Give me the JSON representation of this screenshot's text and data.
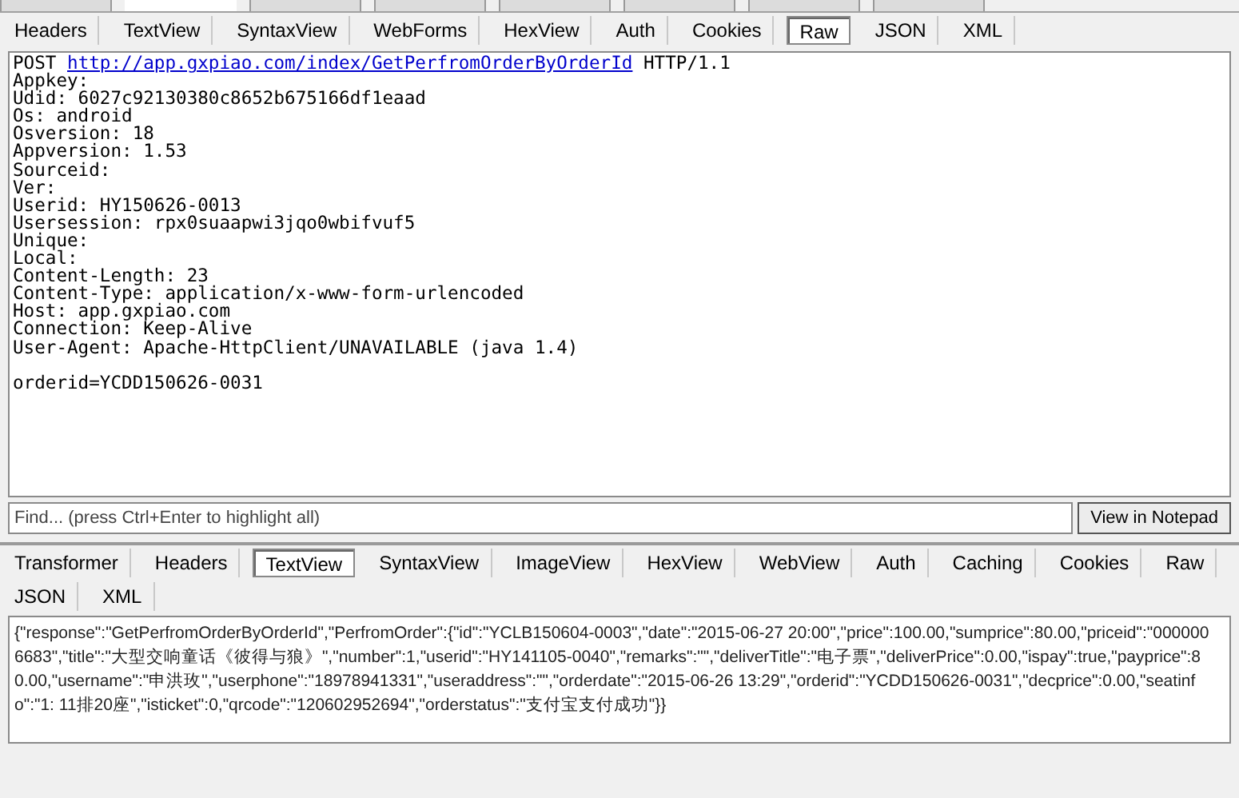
{
  "top_tabs": [
    {
      "selected": false
    },
    {
      "selected": true
    },
    {
      "selected": false
    },
    {
      "selected": false
    },
    {
      "selected": false
    },
    {
      "selected": false
    },
    {
      "selected": false
    },
    {
      "selected": false
    }
  ],
  "request": {
    "tabs": [
      {
        "label": "Headers",
        "selected": false
      },
      {
        "label": "TextView",
        "selected": false
      },
      {
        "label": "SyntaxView",
        "selected": false
      },
      {
        "label": "WebForms",
        "selected": false
      },
      {
        "label": "HexView",
        "selected": false
      },
      {
        "label": "Auth",
        "selected": false
      },
      {
        "label": "Cookies",
        "selected": false
      },
      {
        "label": "Raw",
        "selected": true
      },
      {
        "label": "JSON",
        "selected": false
      },
      {
        "label": "XML",
        "selected": false
      }
    ],
    "request_line": {
      "method": "POST",
      "url": "http://app.gxpiao.com/index/GetPerfromOrderByOrderId",
      "version": "HTTP/1.1"
    },
    "lines": [
      "Appkey:",
      "Udid: 6027c92130380c8652b675166df1eaad",
      "Os: android",
      "Osversion: 18",
      "Appversion: 1.53",
      "Sourceid:",
      "Ver:",
      "Userid: HY150626-0013",
      "Usersession: rpx0suaapwi3jqo0wbifvuf5",
      "Unique:",
      "Local:",
      "Content-Length: 23",
      "Content-Type: application/x-www-form-urlencoded",
      "Host: app.gxpiao.com",
      "Connection: Keep-Alive",
      "User-Agent: Apache-HttpClient/UNAVAILABLE (java 1.4)"
    ],
    "body": "orderid=YCDD150626-0031",
    "find": {
      "placeholder": "Find... (press Ctrl+Enter to highlight all)"
    },
    "notepad_button": "View in Notepad"
  },
  "response": {
    "tabs": [
      {
        "label": "Transformer",
        "selected": false
      },
      {
        "label": "Headers",
        "selected": false
      },
      {
        "label": "TextView",
        "selected": true
      },
      {
        "label": "SyntaxView",
        "selected": false
      },
      {
        "label": "ImageView",
        "selected": false
      },
      {
        "label": "HexView",
        "selected": false
      },
      {
        "label": "WebView",
        "selected": false
      },
      {
        "label": "Auth",
        "selected": false
      },
      {
        "label": "Caching",
        "selected": false
      },
      {
        "label": "Cookies",
        "selected": false
      },
      {
        "label": "Raw",
        "selected": false
      },
      {
        "label": "JSON",
        "selected": false
      },
      {
        "label": "XML",
        "selected": false
      }
    ],
    "body": "{\"response\":\"GetPerfromOrderByOrderId\",\"PerfromOrder\":{\"id\":\"YCLB150604-0003\",\"date\":\"2015-06-27 20:00\",\"price\":100.00,\"sumprice\":80.00,\"priceid\":\"0000006683\",\"title\":\"大型交响童话《彼得与狼》\",\"number\":1,\"userid\":\"HY141105-0040\",\"remarks\":\"\",\"deliverTitle\":\"电子票\",\"deliverPrice\":0.00,\"ispay\":true,\"payprice\":80.00,\"username\":\"申洪玫\",\"userphone\":\"18978941331\",\"useraddress\":\"\",\"orderdate\":\"2015-06-26 13:29\",\"orderid\":\"YCDD150626-0031\",\"decprice\":0.00,\"seatinfo\":\"1: 11排20座\",\"isticket\":0,\"qrcode\":\"120602952694\",\"orderstatus\":\"支付宝支付成功\"}}"
  }
}
